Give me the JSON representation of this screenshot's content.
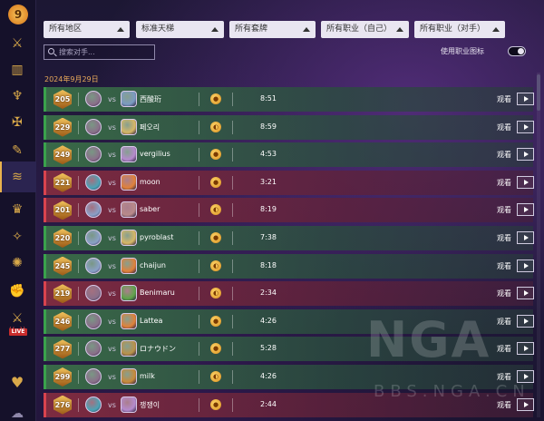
{
  "app": {
    "logo_glyph": "9",
    "accent_color": "#e9b24d"
  },
  "sidebar": {
    "items": [
      {
        "icon": "shield-icon",
        "glyph": "⚔"
      },
      {
        "icon": "card-icon",
        "glyph": "▥"
      },
      {
        "icon": "trophy-icon",
        "glyph": "♆"
      },
      {
        "icon": "book-icon",
        "glyph": "✠"
      },
      {
        "icon": "quill-icon",
        "glyph": "✎"
      },
      {
        "icon": "deck-stack-icon",
        "glyph": "≋",
        "active": true
      },
      {
        "icon": "crown-icon",
        "glyph": "♛"
      },
      {
        "icon": "barrel-icon",
        "glyph": "✧"
      },
      {
        "icon": "gear-orb-icon",
        "glyph": "✺"
      },
      {
        "icon": "fist-icon",
        "glyph": "✊"
      },
      {
        "icon": "crossed-swords-icon",
        "glyph": "⚔"
      },
      {
        "icon": "live-icon",
        "glyph": "((•))",
        "badge": "LIVE"
      },
      {
        "icon": "heart-icon",
        "glyph": "♥"
      },
      {
        "icon": "cloud-icon",
        "glyph": "☁"
      }
    ]
  },
  "filters": {
    "region": "所有地区",
    "ladder": "标准天梯",
    "deck": "所有套牌",
    "own_class": "所有职业（自己）",
    "opp_class": "所有职业（对手）"
  },
  "search": {
    "placeholder": "搜索对手..."
  },
  "toggle": {
    "label": "使用职业图标",
    "on": true
  },
  "date_header": "2024年9月29日",
  "labels": {
    "vs": "vs",
    "watch": "观看"
  },
  "matches": [
    {
      "rank": "205",
      "result": "win",
      "opponent": "西酸珩",
      "coin": "coin",
      "duration": "8:51",
      "own_color": "#8a6f8a",
      "opp_color": "#7b9ac2"
    },
    {
      "rank": "229",
      "result": "win",
      "opponent": "페오리",
      "coin": "no-coin",
      "duration": "8:59",
      "own_color": "#8a6f8a",
      "opp_color": "#d6b766"
    },
    {
      "rank": "249",
      "result": "win",
      "opponent": "vergilius",
      "coin": "coin",
      "duration": "4:53",
      "own_color": "#8a6f8a",
      "opp_color": "#b58acd"
    },
    {
      "rank": "221",
      "result": "loss",
      "opponent": "moon",
      "coin": "coin",
      "duration": "3:21",
      "own_color": "#4aa3b6",
      "opp_color": "#e0813a"
    },
    {
      "rank": "201",
      "result": "loss",
      "opponent": "saber",
      "coin": "no-coin",
      "duration": "8:19",
      "own_color": "#8aa0c8",
      "opp_color": "#b98a8a"
    },
    {
      "rank": "220",
      "result": "win",
      "opponent": "pyroblast",
      "coin": "coin",
      "duration": "7:38",
      "own_color": "#8aa0c8",
      "opp_color": "#d6b766"
    },
    {
      "rank": "245",
      "result": "win",
      "opponent": "chaijun",
      "coin": "no-coin",
      "duration": "8:18",
      "own_color": "#8aa0c8",
      "opp_color": "#e0813a"
    },
    {
      "rank": "219",
      "result": "loss",
      "opponent": "Benimaru",
      "coin": "no-coin",
      "duration": "2:34",
      "own_color": "#8a6f8a",
      "opp_color": "#5fa34a"
    },
    {
      "rank": "246",
      "result": "win",
      "opponent": "Lattea",
      "coin": "coin",
      "duration": "4:26",
      "own_color": "#8a6f8a",
      "opp_color": "#e0813a"
    },
    {
      "rank": "277",
      "result": "win",
      "opponent": "ロナウドン",
      "coin": "coin",
      "duration": "5:28",
      "own_color": "#8a6f8a",
      "opp_color": "#b9924a"
    },
    {
      "rank": "299",
      "result": "win",
      "opponent": "milk",
      "coin": "no-coin",
      "duration": "4:26",
      "own_color": "#8a6f8a",
      "opp_color": "#c88a3a"
    },
    {
      "rank": "276",
      "result": "loss",
      "opponent": "쟁쟁이",
      "coin": "coin",
      "duration": "2:44",
      "own_color": "#4aa3b6",
      "opp_color": "#b58acd"
    }
  ],
  "watermark": {
    "big": "NGA",
    "small": "BBS.NGA.CN"
  }
}
